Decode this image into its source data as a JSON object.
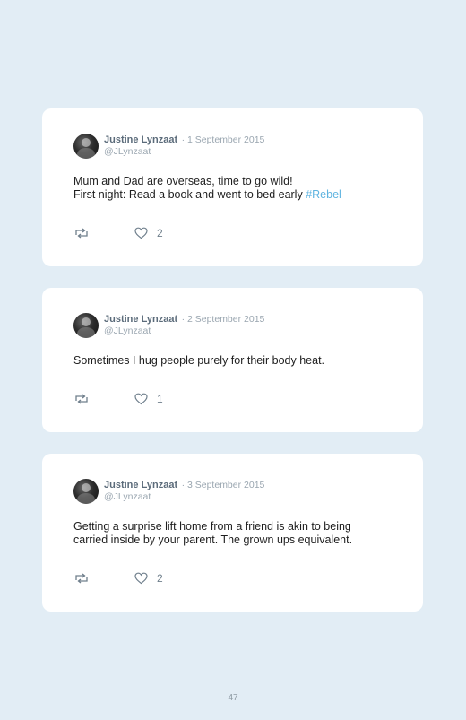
{
  "tweets": [
    {
      "author": "Justine Lynzaat",
      "date": "· 1 September 2015",
      "handle": "@JLynzaat",
      "lines": [
        "Mum and Dad are overseas, time to go wild!",
        "First night: Read a book and went to bed early "
      ],
      "hashtag": "#Rebel",
      "likes": "2"
    },
    {
      "author": "Justine Lynzaat",
      "date": "· 2 September 2015",
      "handle": "@JLynzaat",
      "lines": [
        "Sometimes I hug people purely for their body heat."
      ],
      "likes": "1"
    },
    {
      "author": "Justine Lynzaat",
      "date": "· 3 September 2015",
      "handle": "@JLynzaat",
      "lines": [
        "Getting a surprise lift home from a friend is akin to being",
        "carried inside by your parent. The grown ups equivalent."
      ],
      "likes": "2"
    }
  ],
  "icons": {
    "retweet": "retweet-icon",
    "like": "heart-icon"
  },
  "page_number": "47",
  "colors": {
    "background": "#e2edf5",
    "card": "#ffffff",
    "hashtag": "#5fb4e0",
    "author": "#5b6b7a",
    "muted": "#9aa6b0"
  }
}
